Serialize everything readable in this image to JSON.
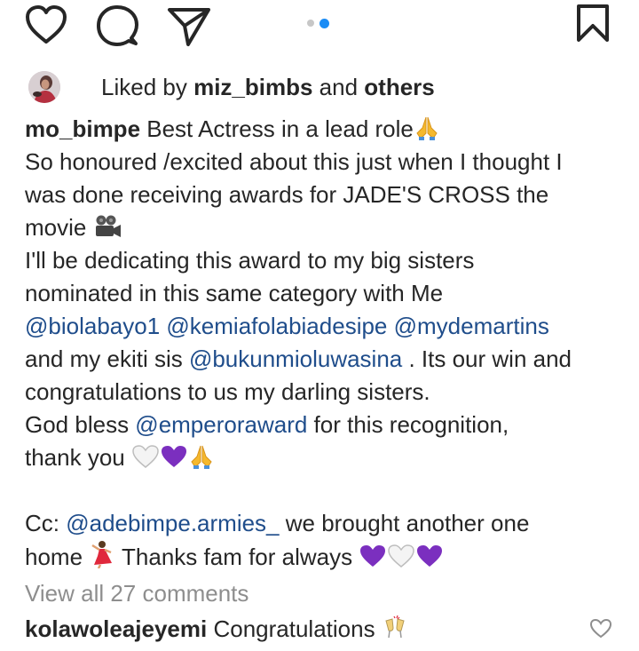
{
  "actions": {
    "like_icon": "heart-outline",
    "comment_icon": "speech-bubble",
    "share_icon": "paper-plane",
    "save_icon": "bookmark-outline",
    "carousel_total": 2,
    "carousel_active": 2,
    "accent_color": "#1a8cf5"
  },
  "likes": {
    "prefix": "Liked by ",
    "user": "miz_bimbs",
    "middle": " and ",
    "others": "others"
  },
  "caption": {
    "author": "mo_bimpe",
    "l1_text": " Best Actress in a lead role",
    "l2": "So honoured /excited about this just when I thought I",
    "l3": "was done receiving awards for JADE'S CROSS the",
    "l4": "movie ",
    "l5": "I'll be dedicating this award to my big sisters",
    "l6": "nominated in this same category with Me",
    "m1": "@biolabayo1",
    "m2": "@kemiafolabiadesipe",
    "m3": "@mydemartins",
    "l8a": "and my ekiti sis ",
    "m4": "@bukunmioluwasina",
    "l8b": " . Its our win and",
    "l9": "congratulations to us my darling sisters.",
    "l10a": "God bless ",
    "m5": "@emperoraward",
    "l10b": " for this recognition,",
    "l11": "thank you ",
    "l13a": "Cc: ",
    "m6": "@adebimpe.armies_",
    "l13b": " we brought another one",
    "l14a": "home ",
    "l14b": " Thanks fam for always ",
    "mention_color": "#1f4d8b"
  },
  "view_all": "View all 27 comments",
  "comment": {
    "user": "kolawoleajeyemi",
    "text": " Congratulations "
  }
}
